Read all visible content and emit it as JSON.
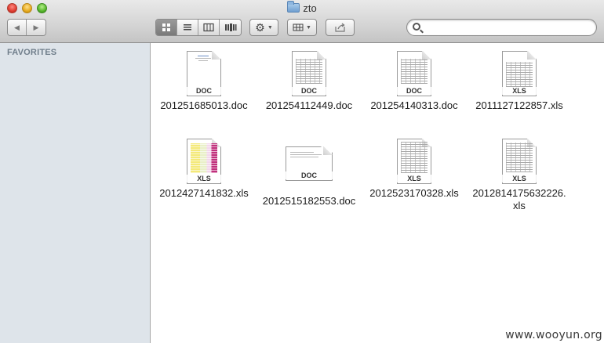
{
  "window": {
    "title": "zto"
  },
  "toolbar": {
    "back_glyph": "◀",
    "forward_glyph": "▶"
  },
  "search": {
    "value": "",
    "placeholder": ""
  },
  "sidebar": {
    "heading": "FAVORITES"
  },
  "files": [
    {
      "name": "201251685013.doc",
      "type_label": "DOC"
    },
    {
      "name": "201254112449.doc",
      "type_label": "DOC"
    },
    {
      "name": "201254140313.doc",
      "type_label": "DOC"
    },
    {
      "name": "2011127122857.xls",
      "type_label": "XLS"
    },
    {
      "name": "2012427141832.xls",
      "type_label": "XLS"
    },
    {
      "name": "2012515182553.doc",
      "type_label": "DOC"
    },
    {
      "name": "2012523170328.xls",
      "type_label": "XLS"
    },
    {
      "name": "2012814175632226.xls",
      "type_label": "XLS"
    }
  ],
  "watermark": "www.wooyun.org"
}
